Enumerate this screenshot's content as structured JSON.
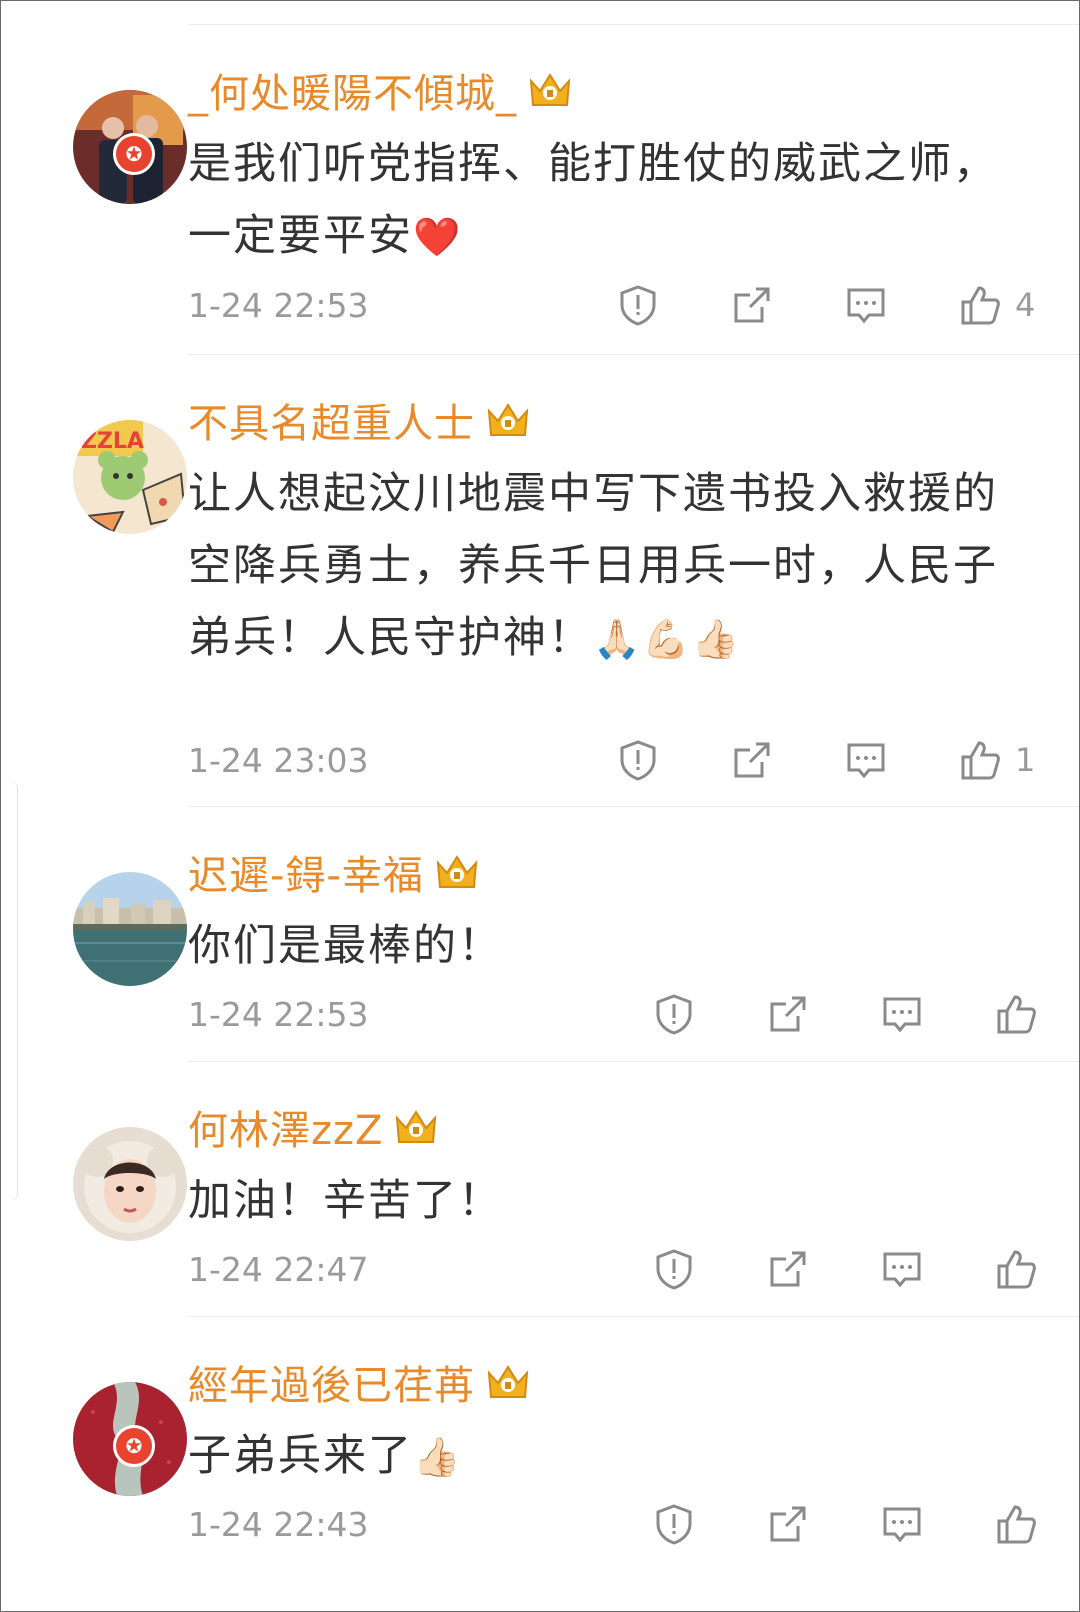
{
  "comments": [
    {
      "username": "_何处暖陽不傾城_",
      "text": "是我们听党指挥、能打胜仗的威武之师，一定要平安",
      "emoji": "❤️",
      "time": "1-24 22:53",
      "likes": "4",
      "verified": true,
      "avatar": "two-men-suits-avatar"
    },
    {
      "username": "不具名超重人士",
      "text": "让人想起汶川地震中写下遗书投入救援的空降兵勇士，养兵千日用兵一时，人民子弟兵！人民守护神！",
      "emoji": "🙏🏻💪🏻👍🏻",
      "time": "1-24 23:03",
      "likes": "1",
      "verified": false,
      "avatar": "cartoon-bear-pizza-avatar"
    },
    {
      "username": "迟遲-鍀-幸福",
      "text": "你们是最棒的！",
      "emoji": "",
      "time": "1-24 22:53",
      "likes": "",
      "verified": false,
      "avatar": "river-city-avatar"
    },
    {
      "username": "何林澤zzZ",
      "text": "加油！辛苦了！",
      "emoji": "",
      "time": "1-24 22:47",
      "likes": "",
      "verified": false,
      "avatar": "girl-portrait-avatar"
    },
    {
      "username": "經年過後已荏苒",
      "text": "子弟兵来了",
      "emoji": "👍🏻",
      "time": "1-24 22:43",
      "likes": "",
      "verified": true,
      "avatar": "red-silhouette-avatar"
    }
  ],
  "icons": {
    "report": "report-icon",
    "share": "share-icon",
    "reply": "comment-icon",
    "like": "thumbs-up-icon",
    "member": "crown-icon"
  },
  "colors": {
    "username": "#e8892a",
    "text": "#333333",
    "meta": "#9a9a9a",
    "crown": "#f2b01e",
    "verified": "#e8432e"
  }
}
